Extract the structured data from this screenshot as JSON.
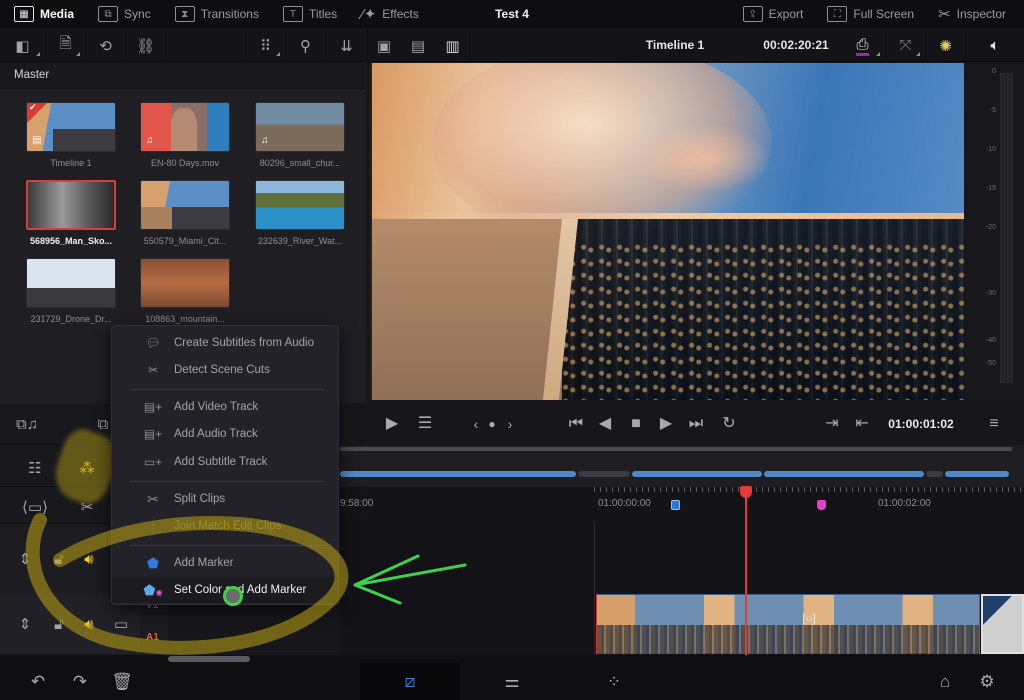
{
  "topbar": {
    "tabs": [
      {
        "label": "Media",
        "icon": "media-pool-icon",
        "active": true
      },
      {
        "label": "Sync",
        "icon": "sync-icon",
        "active": false
      },
      {
        "label": "Transitions",
        "icon": "transitions-icon",
        "active": false
      },
      {
        "label": "Titles",
        "icon": "titles-icon",
        "active": false
      },
      {
        "label": "Effects",
        "icon": "effects-wand-icon",
        "active": false
      }
    ],
    "project_title": "Test 4",
    "right_buttons": [
      {
        "label": "Export",
        "icon": "export-icon"
      },
      {
        "label": "Full Screen",
        "icon": "full-screen-icon"
      },
      {
        "label": "Inspector",
        "icon": "inspector-tools-icon"
      }
    ]
  },
  "toolbar2": {
    "timeline_name": "Timeline 1",
    "timeline_duration": "00:02:20:21"
  },
  "media_pool": {
    "title": "Master",
    "clips": [
      {
        "name": "Timeline 1",
        "type": "timeline",
        "selected": false,
        "checked": true
      },
      {
        "name": "EN-80 Days.mov",
        "type": "audio-video",
        "selected": false,
        "checked": false
      },
      {
        "name": "80296_small_chur...",
        "type": "audio-video",
        "selected": false,
        "checked": false
      },
      {
        "name": "568956_Man_Sko...",
        "type": "video",
        "selected": true,
        "checked": false
      },
      {
        "name": "550579_Miami_Cit...",
        "type": "video",
        "selected": false,
        "checked": false
      },
      {
        "name": "232639_River_Wat...",
        "type": "video",
        "selected": false,
        "checked": false
      },
      {
        "name": "231729_Drone_Dr...",
        "type": "video",
        "selected": false,
        "checked": false
      },
      {
        "name": "108863_mountain...",
        "type": "video",
        "selected": false,
        "checked": false
      }
    ]
  },
  "audio_meter": {
    "scale": [
      "0",
      "-5",
      "-10",
      "-15",
      "-20",
      "-30",
      "-40",
      "-50"
    ]
  },
  "viewer_controls": {
    "timecode": "01:00:01:02"
  },
  "timeline": {
    "ruler_labels": [
      "9:58:00",
      "01:00:00:00",
      "01:00:02:00"
    ],
    "tracks": [
      {
        "label": "V1",
        "color": "#d9453b"
      },
      {
        "label": "A1",
        "color": "#e0612a"
      }
    ],
    "markers": [
      {
        "color": "#2a78d4"
      },
      {
        "color": "#e440c8"
      }
    ],
    "transition_glyph": "[‹›]"
  },
  "context_menu": {
    "sections": [
      [
        {
          "label": "Create Subtitles from Audio",
          "icon": "subtitles-audio-icon",
          "state": "normal"
        },
        {
          "label": "Detect Scene Cuts",
          "icon": "scene-cut-icon",
          "state": "normal"
        }
      ],
      [
        {
          "label": "Add Video Track",
          "icon": "add-video-track-icon",
          "state": "normal"
        },
        {
          "label": "Add Audio Track",
          "icon": "add-audio-track-icon",
          "state": "normal"
        },
        {
          "label": "Add Subtitle Track",
          "icon": "add-subtitle-track-icon",
          "state": "normal"
        }
      ],
      [
        {
          "label": "Split Clips",
          "icon": "scissors-icon",
          "state": "normal"
        },
        {
          "label": "Join Match Edit Clips",
          "icon": "join-clips-icon",
          "state": "disabled"
        }
      ],
      [
        {
          "label": "Add Marker",
          "icon": "marker-icon",
          "state": "normal"
        },
        {
          "label": "Set Color and Add Marker",
          "icon": "color-marker-icon",
          "state": "hovered"
        }
      ]
    ]
  },
  "colors": {
    "accent_blue": "#3a7fe0",
    "playhead_red": "#e63a36",
    "annotation_yellow": "#bfa514",
    "annotation_green": "#3fd14b"
  }
}
